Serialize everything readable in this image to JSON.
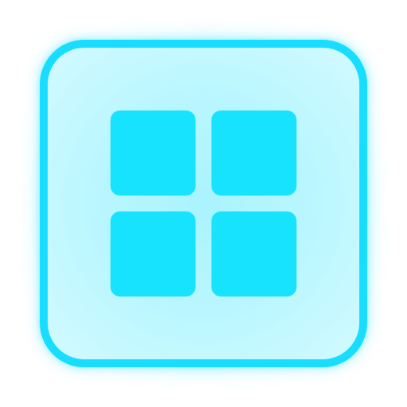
{
  "icon": {
    "name": "grid-icon",
    "colors": {
      "background": "#FFFFFF",
      "border": "#18DDFF",
      "fill_center": "#A9F4FF",
      "fill_edge": "#D2FAFF",
      "tile": "#18E3FF"
    },
    "tiles": [
      {
        "position": "top-left"
      },
      {
        "position": "top-right"
      },
      {
        "position": "bottom-left"
      },
      {
        "position": "bottom-right"
      }
    ]
  }
}
